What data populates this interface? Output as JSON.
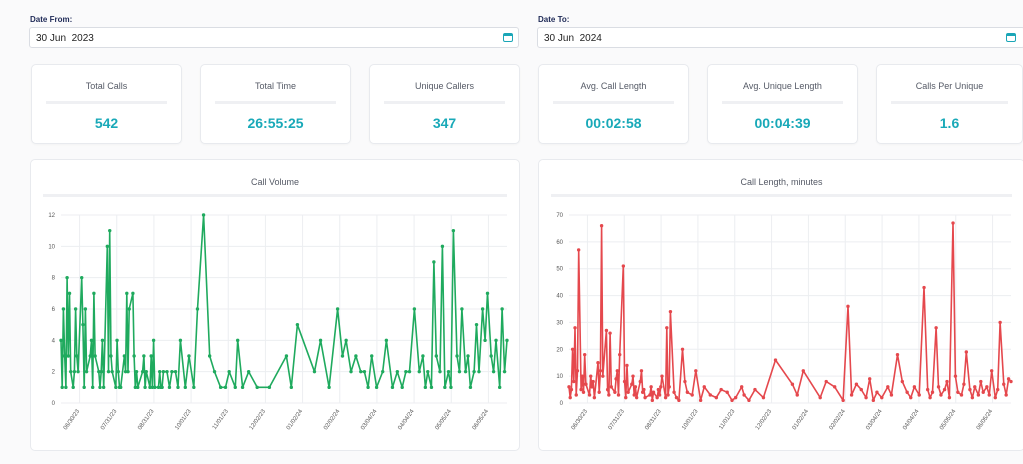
{
  "date_from": {
    "label": "Date From:",
    "value": "30 Jun  2023"
  },
  "date_to": {
    "label": "Date To:",
    "value": "30 Jun  2024"
  },
  "stats": [
    {
      "title": "Total Calls",
      "value": "542"
    },
    {
      "title": "Total Time",
      "value": "26:55:25"
    },
    {
      "title": "Unique Callers",
      "value": "347"
    },
    {
      "title": "Avg. Call Length",
      "value": "00:02:58"
    },
    {
      "title": "Avg. Unique Length",
      "value": "00:04:39"
    },
    {
      "title": "Calls Per Unique",
      "value": "1.6"
    }
  ],
  "colors": {
    "accent": "#19a9b8",
    "volume_line": "#1faa5e",
    "length_line": "#e5484d"
  },
  "chart_data": [
    {
      "type": "line",
      "title": "Call Volume",
      "xlabel": "",
      "ylabel": "",
      "ylim": [
        0,
        12
      ],
      "yticks": [
        "0",
        "2",
        "4",
        "6",
        "8",
        "10",
        "12"
      ],
      "xticks": [
        "06/30/23",
        "07/31/23",
        "08/31/23",
        "10/01/23",
        "11/01/23",
        "12/02/23",
        "01/02/24",
        "02/02/24",
        "03/04/24",
        "04/04/24",
        "05/05/24",
        "06/05/24"
      ],
      "x": [
        "2023-06-30",
        "2023-07-01",
        "2023-07-02",
        "2023-07-03",
        "2023-07-04",
        "2023-07-05",
        "2023-07-06",
        "2023-07-07",
        "2023-07-08",
        "2023-07-10",
        "2023-07-11",
        "2023-07-12",
        "2023-07-13",
        "2023-07-14",
        "2023-07-17",
        "2023-07-18",
        "2023-07-19",
        "2023-07-20",
        "2023-07-21",
        "2023-07-24",
        "2023-07-25",
        "2023-07-26",
        "2023-07-27",
        "2023-07-28",
        "2023-07-31",
        "2023-08-01",
        "2023-08-02",
        "2023-08-03",
        "2023-08-04",
        "2023-08-07",
        "2023-08-08",
        "2023-08-09",
        "2023-08-10",
        "2023-08-11",
        "2023-08-14",
        "2023-08-15",
        "2023-08-16",
        "2023-08-17",
        "2023-08-18",
        "2023-08-21",
        "2023-08-22",
        "2023-08-23",
        "2023-08-24",
        "2023-08-25",
        "2023-08-28",
        "2023-08-29",
        "2023-08-30",
        "2023-08-31",
        "2023-09-01",
        "2023-09-05",
        "2023-09-06",
        "2023-09-07",
        "2023-09-08",
        "2023-09-11",
        "2023-09-12",
        "2023-09-13",
        "2023-09-14",
        "2023-09-15",
        "2023-09-18",
        "2023-09-19",
        "2023-09-20",
        "2023-09-21",
        "2023-09-22",
        "2023-09-25",
        "2023-09-27",
        "2023-09-29",
        "2023-10-02",
        "2023-10-04",
        "2023-10-06",
        "2023-10-10",
        "2023-10-13",
        "2023-10-17",
        "2023-10-20",
        "2023-10-25",
        "2023-10-30",
        "2023-11-03",
        "2023-11-08",
        "2023-11-12",
        "2023-11-15",
        "2023-11-20",
        "2023-11-22",
        "2023-11-26",
        "2023-12-01",
        "2023-12-08",
        "2023-12-18",
        "2024-01-01",
        "2024-01-05",
        "2024-01-10",
        "2024-01-24",
        "2024-01-29",
        "2024-02-05",
        "2024-02-12",
        "2024-02-16",
        "2024-02-19",
        "2024-02-23",
        "2024-02-27",
        "2024-03-02",
        "2024-03-05",
        "2024-03-08",
        "2024-03-11",
        "2024-03-15",
        "2024-03-20",
        "2024-03-23",
        "2024-03-28",
        "2024-04-01",
        "2024-04-05",
        "2024-04-08",
        "2024-04-11",
        "2024-04-15",
        "2024-04-19",
        "2024-04-22",
        "2024-04-24",
        "2024-04-26",
        "2024-04-29",
        "2024-05-01",
        "2024-05-03",
        "2024-05-06",
        "2024-05-08",
        "2024-05-10",
        "2024-05-13",
        "2024-05-15",
        "2024-05-17",
        "2024-05-20",
        "2024-05-22",
        "2024-05-24",
        "2024-05-27",
        "2024-05-29",
        "2024-05-31",
        "2024-06-03",
        "2024-06-05",
        "2024-06-07",
        "2024-06-10",
        "2024-06-12",
        "2024-06-14",
        "2024-06-17",
        "2024-06-19",
        "2024-06-21",
        "2024-06-24",
        "2024-06-26",
        "2024-06-28",
        "2024-06-30"
      ],
      "series": [
        {
          "values": [
            4,
            1,
            6,
            3,
            1,
            8,
            3,
            7,
            2,
            1,
            2,
            6,
            3,
            2,
            8,
            5,
            1,
            6,
            2,
            3,
            4,
            1,
            7,
            3,
            2,
            1,
            2,
            4,
            1,
            10,
            2,
            11,
            3,
            2,
            1,
            4,
            2,
            1,
            1,
            3,
            2,
            7,
            2,
            6,
            7,
            3,
            1,
            2,
            1,
            2,
            3,
            1,
            2,
            1,
            3,
            1,
            4,
            1,
            1,
            2,
            1,
            1,
            2,
            2,
            1,
            2,
            2,
            1,
            4,
            1,
            3,
            1,
            6,
            12,
            3,
            2,
            1,
            1,
            2,
            1,
            4,
            1,
            2,
            1,
            1,
            3,
            1,
            5,
            2,
            4,
            1,
            6,
            3,
            4,
            2,
            3,
            2,
            2,
            1,
            3,
            1,
            2,
            4,
            1,
            2,
            1,
            2,
            2,
            6,
            2,
            3,
            1,
            2,
            1,
            9,
            3,
            2,
            10,
            1,
            2,
            1,
            11,
            3,
            2,
            6,
            2,
            3,
            1,
            2,
            5,
            2,
            6,
            4,
            7,
            3,
            2,
            4,
            1,
            6,
            2,
            4
          ]
        }
      ]
    },
    {
      "type": "line",
      "title": "Call Length, minutes",
      "xlabel": "",
      "ylabel": "",
      "ylim": [
        0,
        70
      ],
      "yticks": [
        "0",
        "10",
        "20",
        "30",
        "40",
        "50",
        "60",
        "70"
      ],
      "xticks": [
        "06/30/23",
        "07/31/23",
        "08/31/23",
        "10/01/23",
        "11/01/23",
        "12/02/23",
        "01/02/24",
        "02/02/24",
        "03/04/24",
        "04/04/24",
        "05/05/24",
        "06/05/24"
      ],
      "x": [
        "2023-06-30",
        "2023-07-01",
        "2023-07-02",
        "2023-07-03",
        "2023-07-04",
        "2023-07-05",
        "2023-07-06",
        "2023-07-07",
        "2023-07-08",
        "2023-07-10",
        "2023-07-11",
        "2023-07-12",
        "2023-07-13",
        "2023-07-14",
        "2023-07-17",
        "2023-07-18",
        "2023-07-19",
        "2023-07-20",
        "2023-07-21",
        "2023-07-24",
        "2023-07-25",
        "2023-07-26",
        "2023-07-27",
        "2023-07-28",
        "2023-07-31",
        "2023-08-01",
        "2023-08-02",
        "2023-08-03",
        "2023-08-04",
        "2023-08-07",
        "2023-08-08",
        "2023-08-09",
        "2023-08-10",
        "2023-08-11",
        "2023-08-14",
        "2023-08-15",
        "2023-08-16",
        "2023-08-17",
        "2023-08-18",
        "2023-08-21",
        "2023-08-22",
        "2023-08-23",
        "2023-08-24",
        "2023-08-25",
        "2023-08-28",
        "2023-08-29",
        "2023-08-30",
        "2023-08-31",
        "2023-09-01",
        "2023-09-05",
        "2023-09-06",
        "2023-09-07",
        "2023-09-08",
        "2023-09-11",
        "2023-09-12",
        "2023-09-13",
        "2023-09-14",
        "2023-09-15",
        "2023-09-18",
        "2023-09-19",
        "2023-09-20",
        "2023-09-21",
        "2023-09-22",
        "2023-09-25",
        "2023-09-27",
        "2023-09-29",
        "2023-10-02",
        "2023-10-04",
        "2023-10-06",
        "2023-10-10",
        "2023-10-13",
        "2023-10-17",
        "2023-10-20",
        "2023-10-25",
        "2023-10-30",
        "2023-11-03",
        "2023-11-08",
        "2023-11-12",
        "2023-11-15",
        "2023-11-20",
        "2023-11-22",
        "2023-11-26",
        "2023-12-01",
        "2023-12-08",
        "2023-12-18",
        "2024-01-01",
        "2024-01-05",
        "2024-01-10",
        "2024-01-24",
        "2024-01-29",
        "2024-02-05",
        "2024-02-12",
        "2024-02-16",
        "2024-02-19",
        "2024-02-23",
        "2024-02-27",
        "2024-03-02",
        "2024-03-05",
        "2024-03-08",
        "2024-03-11",
        "2024-03-15",
        "2024-03-20",
        "2024-03-23",
        "2024-03-28",
        "2024-04-01",
        "2024-04-05",
        "2024-04-08",
        "2024-04-11",
        "2024-04-15",
        "2024-04-19",
        "2024-04-22",
        "2024-04-24",
        "2024-04-26",
        "2024-04-29",
        "2024-05-01",
        "2024-05-03",
        "2024-05-06",
        "2024-05-08",
        "2024-05-10",
        "2024-05-13",
        "2024-05-15",
        "2024-05-17",
        "2024-05-20",
        "2024-05-22",
        "2024-05-24",
        "2024-05-27",
        "2024-05-29",
        "2024-05-31",
        "2024-06-03",
        "2024-06-05",
        "2024-06-07",
        "2024-06-10",
        "2024-06-12",
        "2024-06-14",
        "2024-06-17",
        "2024-06-19",
        "2024-06-21",
        "2024-06-24",
        "2024-06-26",
        "2024-06-28",
        "2024-06-30"
      ],
      "series": [
        {
          "values": [
            6,
            2,
            5,
            20,
            8,
            28,
            3,
            12,
            57,
            5,
            10,
            4,
            18,
            7,
            3,
            10,
            6,
            8,
            2,
            15,
            4,
            12,
            66,
            10,
            27,
            5,
            3,
            26,
            6,
            4,
            9,
            12,
            3,
            18,
            51,
            8,
            2,
            14,
            4,
            7,
            10,
            3,
            6,
            2,
            8,
            12,
            4,
            5,
            2,
            3,
            6,
            1,
            4,
            2,
            5,
            3,
            6,
            10,
            2,
            28,
            3,
            6,
            34,
            4,
            2,
            1,
            20,
            8,
            4,
            3,
            12,
            1,
            6,
            3,
            2,
            5,
            4,
            1,
            2,
            6,
            3,
            1,
            5,
            2,
            16,
            7,
            3,
            12,
            2,
            8,
            6,
            1,
            36,
            3,
            7,
            5,
            2,
            9,
            1,
            4,
            2,
            6,
            3,
            18,
            8,
            4,
            2,
            6,
            3,
            43,
            5,
            2,
            4,
            28,
            6,
            3,
            5,
            8,
            2,
            67,
            10,
            4,
            3,
            7,
            19,
            5,
            2,
            6,
            3,
            8,
            4,
            6,
            3,
            12,
            2,
            5,
            30,
            7,
            3,
            9,
            8
          ]
        }
      ]
    }
  ]
}
